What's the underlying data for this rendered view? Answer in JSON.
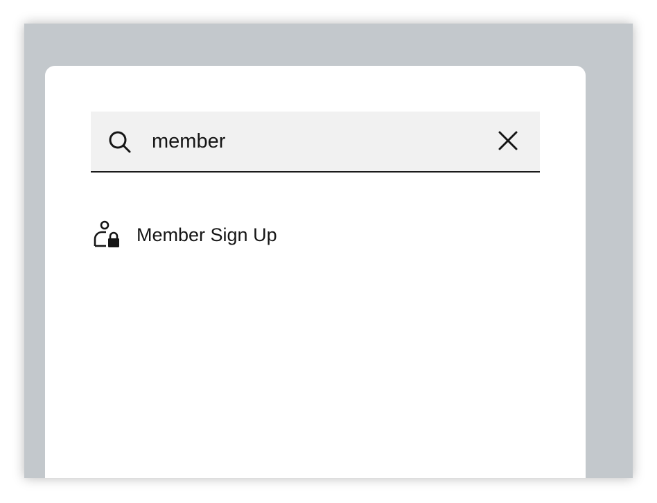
{
  "search": {
    "value": "member",
    "icon": "search-icon",
    "clear_icon": "close-icon"
  },
  "results": [
    {
      "label": "Member Sign Up",
      "icon": "member-lock-icon"
    }
  ],
  "colors": {
    "backdrop": "#c3c8cc",
    "panel": "#ffffff",
    "search_bg": "#f1f1f1",
    "text": "#151515"
  }
}
